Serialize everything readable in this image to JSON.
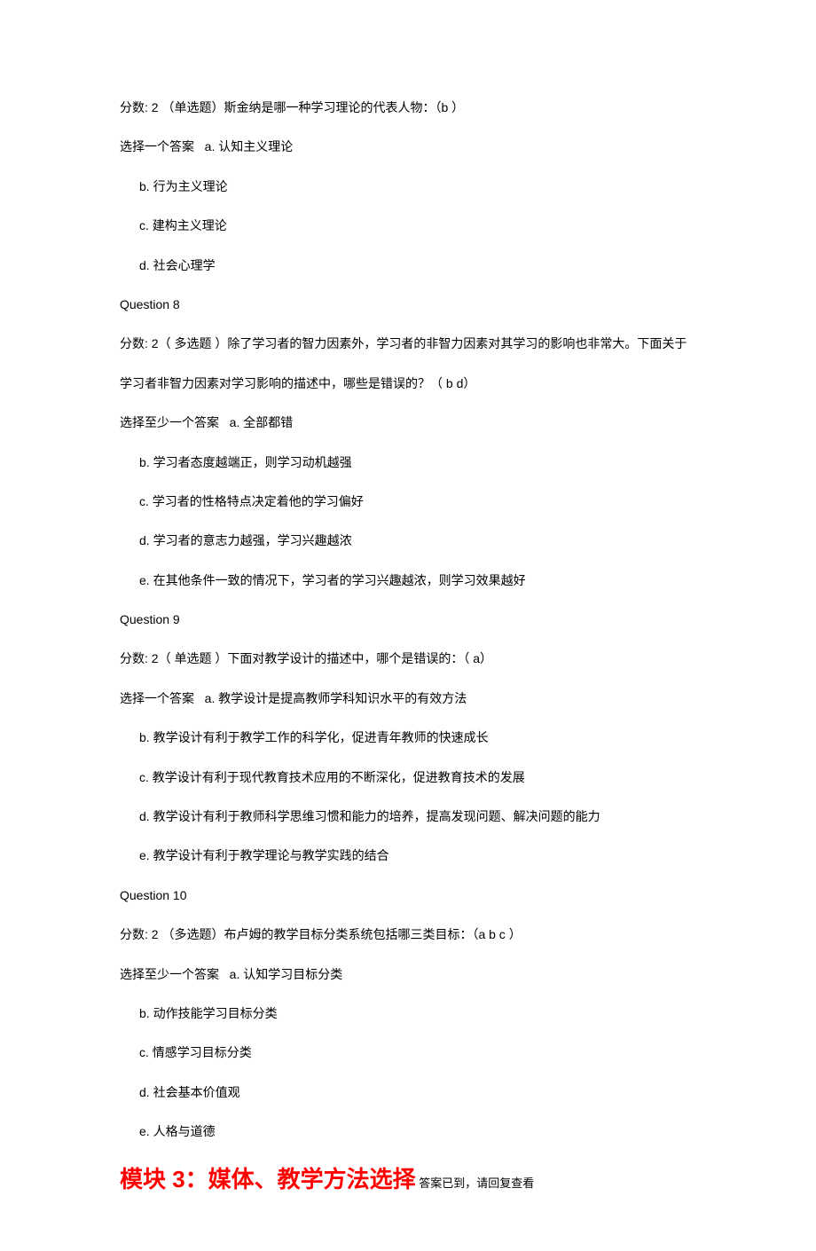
{
  "q7": {
    "prefix": "分数: 2 （单选题）斯金纳是哪一种学习理论的代表人物：（b ）",
    "chooseLabel": "选择一个答案",
    "optA": "a. 认知主义理论",
    "optB": "b. 行为主义理论",
    "optC": "c. 建构主义理论",
    "optD": "d. 社会心理学"
  },
  "q8": {
    "header": "Question  8",
    "line1": "分数: 2（ 多选题 ）除了学习者的智力因素外，学习者的非智力因素对其学习的影响也非常大。下面关于",
    "line2": "学习者非智力因素对学习影响的描述中，哪些是错误的？（ b  d）",
    "chooseLabel": "选择至少一个答案",
    "optA": "a. 全部都错",
    "optB": "b. 学习者态度越端正，则学习动机越强",
    "optC": "c. 学习者的性格特点决定着他的学习偏好",
    "optD": "d. 学习者的意志力越强，学习兴趣越浓",
    "optE": "e. 在其他条件一致的情况下，学习者的学习兴趣越浓，则学习效果越好"
  },
  "q9": {
    "header": "Question  9",
    "prefix": "分数: 2（ 单选题 ）下面对教学设计的描述中，哪个是错误的：（ a）",
    "chooseLabel": "选择一个答案",
    "optA": "a. 教学设计是提高教师学科知识水平的有效方法",
    "optB": "b. 教学设计有利于教学工作的科学化，促进青年教师的快速成长",
    "optC": "c. 教学设计有利于现代教育技术应用的不断深化，促进教育技术的发展",
    "optD": "d. 教学设计有利于教师科学思维习惯和能力的培养，提高发现问题、解决问题的能力",
    "optE": "e. 教学设计有利于教学理论与教学实践的结合"
  },
  "q10": {
    "header": "Question  10",
    "prefix": "分数: 2 （多选题）布卢姆的教学目标分类系统包括哪三类目标：（a  b  c ）",
    "chooseLabel": "选择至少一个答案",
    "optA": "a. 认知学习目标分类",
    "optB": "b. 动作技能学习目标分类",
    "optC": "c. 情感学习目标分类",
    "optD": "d. 社会基本价值观",
    "optE": "e. 人格与道德"
  },
  "section": {
    "title": "模块 3：媒体、教学方法选择",
    "suffix": " 答案已到，请回复查看"
  }
}
